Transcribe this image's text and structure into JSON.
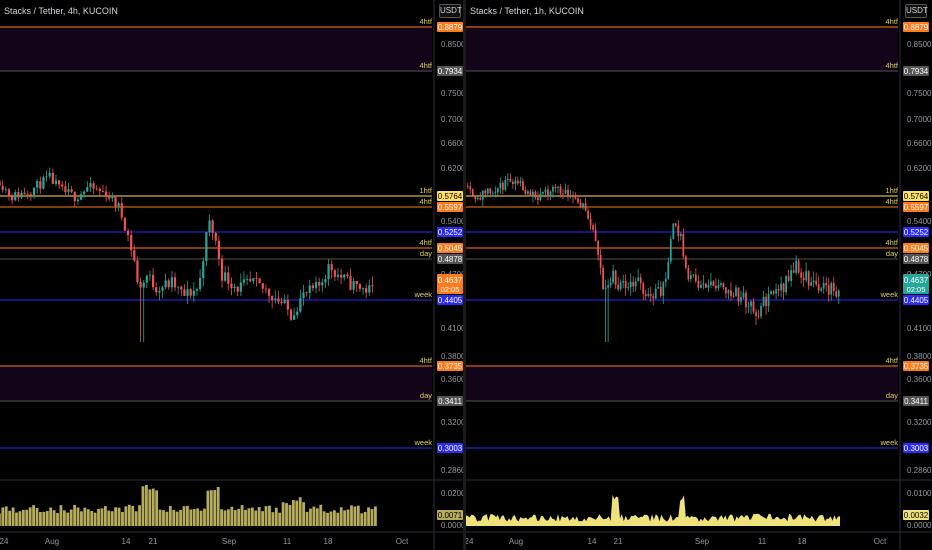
{
  "colors": {
    "orange": "#ff7a1a",
    "purple_zone": "#12051a",
    "blue": "#2a2aff",
    "yellow": "#ffe066",
    "gray": "#555555",
    "candle_up": "#26a69a",
    "candle_down": "#ef5350",
    "volume_left": "#b5ac5e",
    "volume_right": "#f0e27a"
  },
  "panes": [
    {
      "symbol_title": "Stacks / Tether, 4h, KUCOIN",
      "currency_button": "USDT",
      "volume_style": "left",
      "price_ticks": [
        "0.8500",
        "0.7500",
        "0.7000",
        "0.6600",
        "0.6200",
        "0.5400",
        "0.4700",
        "0.4100",
        "0.3800",
        "0.3600",
        "0.3200",
        "0.2860"
      ],
      "level_labels": [
        {
          "tag": "4htf",
          "price": "0.8879",
          "color": "orange"
        },
        {
          "tag": "4htf",
          "price": "0.7934",
          "color": "gray"
        },
        {
          "tag": "1htf",
          "price": "0.5764",
          "color": "yellow"
        },
        {
          "tag": "4htf",
          "price": "0.5597",
          "color": "orange"
        },
        {
          "tag": "",
          "price": "0.5252",
          "color": "blue"
        },
        {
          "tag": "4htf",
          "price": "0.5045",
          "color": "orange"
        },
        {
          "tag": "day",
          "price": "0.4878",
          "color": "gray"
        },
        {
          "tag": "",
          "price": "0.4637",
          "color": "orange"
        },
        {
          "tag": "week",
          "price": "0.4405",
          "color": "blue"
        },
        {
          "tag": "4htf",
          "price": "0.3735",
          "color": "orange"
        },
        {
          "tag": "day",
          "price": "0.3411",
          "color": "gray"
        },
        {
          "tag": "week",
          "price": "0.3003",
          "color": "blue"
        }
      ],
      "countdown": "02:05",
      "volume_ticks": [
        "0.0200",
        "0.0000"
      ],
      "volume_last": "0.0071",
      "time_labels": [
        "24",
        "Aug",
        "14",
        "21",
        "Sep",
        "11",
        "18",
        "Oct"
      ]
    },
    {
      "symbol_title": "Stacks / Tether, 1h, KUCOIN",
      "currency_button": "USDT",
      "volume_style": "right",
      "price_ticks": [
        "0.8500",
        "0.7500",
        "0.7000",
        "0.6600",
        "0.6200",
        "0.5400",
        "0.4700",
        "0.4100",
        "0.3800",
        "0.3600",
        "0.3200",
        "0.2860"
      ],
      "level_labels": [
        {
          "tag": "4htf",
          "price": "0.8879",
          "color": "orange"
        },
        {
          "tag": "4htf",
          "price": "0.7934",
          "color": "gray"
        },
        {
          "tag": "1htf",
          "price": "0.5764",
          "color": "yellow"
        },
        {
          "tag": "4htf",
          "price": "0.5597",
          "color": "orange"
        },
        {
          "tag": "",
          "price": "0.5252",
          "color": "blue"
        },
        {
          "tag": "4htf",
          "price": "0.5045",
          "color": "orange"
        },
        {
          "tag": "day",
          "price": "0.4878",
          "color": "gray"
        },
        {
          "tag": "",
          "price": "0.4637",
          "color": "teal"
        },
        {
          "tag": "week",
          "price": "0.4405",
          "color": "blue"
        },
        {
          "tag": "4htf",
          "price": "0.3735",
          "color": "orange"
        },
        {
          "tag": "day",
          "price": "0.3411",
          "color": "gray"
        },
        {
          "tag": "week",
          "price": "0.3003",
          "color": "blue"
        }
      ],
      "countdown": "02:05",
      "volume_ticks": [
        "0.0100",
        "0.0000"
      ],
      "volume_last": "0.0032",
      "time_labels": [
        "24",
        "Aug",
        "14",
        "21",
        "Sep",
        "11",
        "18",
        "Oct"
      ]
    }
  ]
}
